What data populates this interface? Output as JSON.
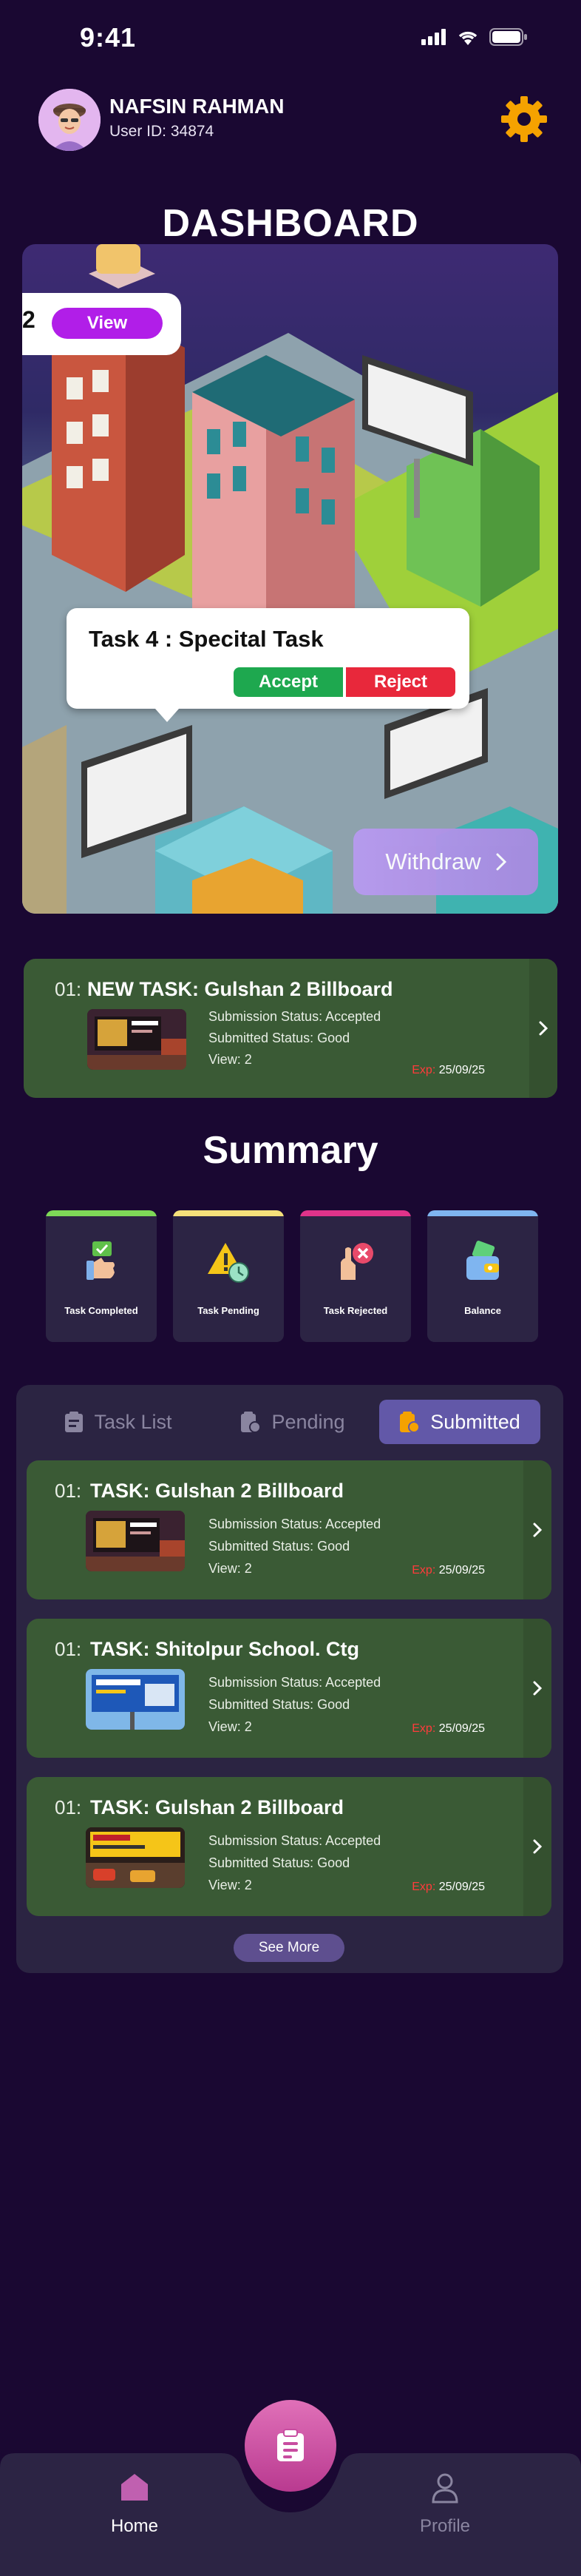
{
  "status_bar": {
    "time": "9:41"
  },
  "user": {
    "name": "NAFSIN RAHMAN",
    "id_text": "User ID: 34874"
  },
  "dashboard_title": "DASHBOARD",
  "hero": {
    "view_number": "2",
    "view_label": "View",
    "task_title": "Task 4 : Specital Task",
    "accept_label": "Accept",
    "reject_label": "Reject",
    "withdraw_label": "Withdraw"
  },
  "new_task": {
    "num": "01:",
    "title": "NEW TASK: Gulshan 2 Billboard",
    "submission_status": "Submission Status: Accepted",
    "submitted_status": "Submitted Status: Good",
    "views": "View: 2",
    "exp_label": "Exp:",
    "exp_date": "25/09/25"
  },
  "summary": {
    "title": "Summary",
    "cards": [
      {
        "label": "Task Completed",
        "accent": "#7ed957",
        "icon": "thumbs-up-check-icon"
      },
      {
        "label": "Task Pending",
        "accent": "#f5e07a",
        "icon": "warning-clock-icon"
      },
      {
        "label": "Task Rejected",
        "accent": "#e0338a",
        "icon": "hand-x-icon"
      },
      {
        "label": "Balance",
        "accent": "#7fb5f0",
        "icon": "wallet-icon"
      }
    ]
  },
  "tabs": [
    {
      "label": "Task List",
      "active": false
    },
    {
      "label": "Pending",
      "active": false
    },
    {
      "label": "Submitted",
      "active": true
    }
  ],
  "submitted_tasks": [
    {
      "num": "01:",
      "title": "TASK: Gulshan 2 Billboard",
      "submission_status": "Submission Status: Accepted",
      "submitted_status": "Submitted Status: Good",
      "views": "View: 2",
      "exp_label": "Exp:",
      "exp_date": "25/09/25"
    },
    {
      "num": "01:",
      "title": "TASK: Shitolpur School. Ctg",
      "submission_status": "Submission Status: Accepted",
      "submitted_status": "Submitted Status: Good",
      "views": "View: 2",
      "exp_label": "Exp:",
      "exp_date": "25/09/25"
    },
    {
      "num": "01:",
      "title": "TASK: Gulshan 2 Billboard",
      "submission_status": "Submission Status: Accepted",
      "submitted_status": "Submitted Status: Good",
      "views": "View: 2",
      "exp_label": "Exp:",
      "exp_date": "25/09/25"
    }
  ],
  "see_more_label": "See More",
  "bottom_nav": {
    "home_label": "Home",
    "profile_label": "Profile"
  },
  "colors": {
    "background": "#1a0832",
    "card_green": "#3a5a35",
    "accent_purple": "#b11ee8",
    "accept": "#1ea84f",
    "reject": "#e8283b",
    "settings_gear": "#f5a200"
  }
}
